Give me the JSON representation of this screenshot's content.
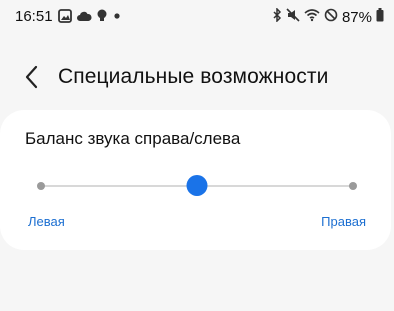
{
  "status_bar": {
    "time": "16:51",
    "battery_percent": "87%",
    "left_icons": [
      "image-icon",
      "cloud-icon",
      "bulb-icon",
      "dot-icon"
    ],
    "right_icons": [
      "bluetooth-icon",
      "mute-icon",
      "wifi-icon",
      "no-disturb-icon",
      "battery-icon"
    ]
  },
  "app_bar": {
    "title": "Специальные возможности",
    "back_icon": "chevron-left-icon"
  },
  "balance_card": {
    "title": "Баланс звука справа/слева",
    "left_label": "Левая",
    "right_label": "Правая",
    "value_fraction": 0.5
  },
  "colors": {
    "accent": "#1a73e8",
    "label_blue": "#1c6fd1",
    "background": "#f6f6f6",
    "card": "#ffffff"
  }
}
